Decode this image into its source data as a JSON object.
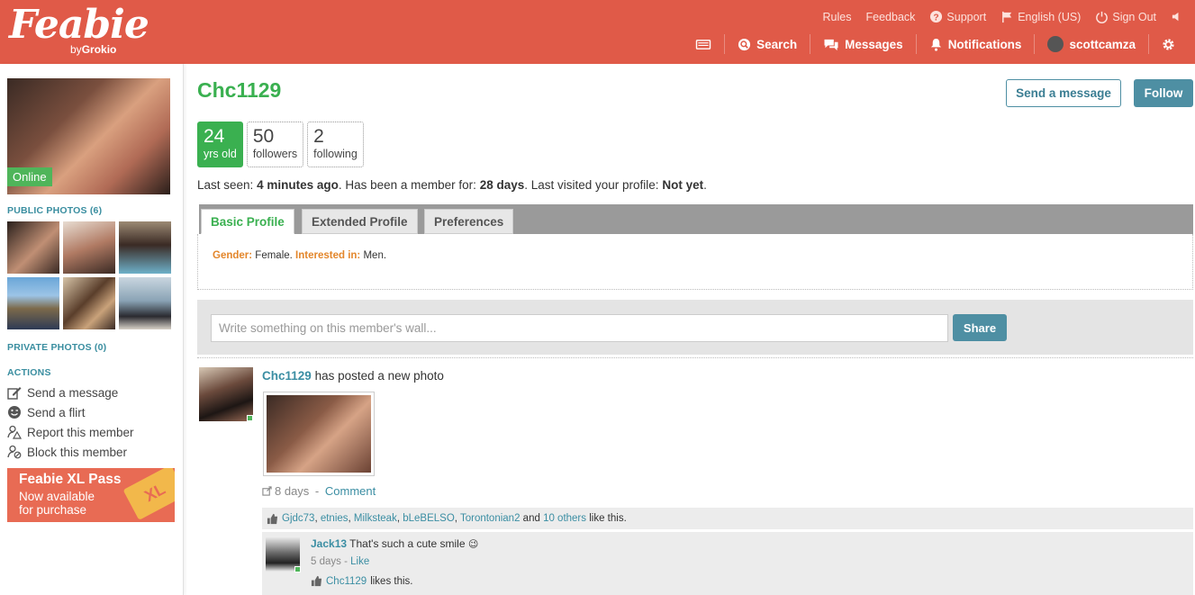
{
  "brand": {
    "name": "Feabie",
    "by_prefix": "by",
    "by_name": "Grokio"
  },
  "colors": {
    "header": "#e05a48",
    "green": "#3ab050",
    "teal": "#4e8fa3",
    "orange": "#e3862b",
    "online": "#4fb55a"
  },
  "top_links": [
    {
      "label": "Rules",
      "icon": ""
    },
    {
      "label": "Feedback",
      "icon": ""
    },
    {
      "label": "Support",
      "icon": "question-icon"
    },
    {
      "label": "English (US)",
      "icon": "flag-icon"
    },
    {
      "label": "Sign Out",
      "icon": "power-icon"
    }
  ],
  "nav": {
    "search": "Search",
    "messages": "Messages",
    "notifications": "Notifications",
    "username": "scottcamza"
  },
  "left": {
    "online_badge": "Online",
    "public_photos_title": "PUBLIC PHOTOS (6)",
    "private_photos_title": "PRIVATE PHOTOS (0)",
    "actions_title": "ACTIONS",
    "actions": {
      "send_message": "Send a message",
      "send_flirt": "Send a flirt",
      "report": "Report this member",
      "block": "Block this member"
    },
    "xl_pass": {
      "title": "Feabie XL Pass",
      "line1": "Now available",
      "line2": "for purchase",
      "badge": "XL"
    }
  },
  "profile": {
    "username": "Chc1129",
    "send_message_button": "Send a message",
    "follow_button": "Follow",
    "stats": {
      "age": {
        "value": "24",
        "label": "yrs old"
      },
      "followers": {
        "value": "50",
        "label": "followers"
      },
      "following": {
        "value": "2",
        "label": "following"
      }
    },
    "last_seen": {
      "prefix": "Last seen:",
      "value": "4 minutes ago",
      "member_prefix": ". Has been a member for:",
      "member_value": "28 days",
      "visited_prefix": ". Last visited your profile:",
      "visited_value": "Not yet",
      "end": "."
    },
    "tabs": {
      "basic": "Basic Profile",
      "extended": "Extended Profile",
      "preferences": "Preferences"
    },
    "basic": {
      "gender_label": "Gender:",
      "gender_value": "Female.",
      "interested_label": "Interested in:",
      "interested_value": "Men."
    }
  },
  "wall": {
    "placeholder": "Write something on this member's wall...",
    "share_button": "Share"
  },
  "post": {
    "author": "Chc1129",
    "action_text": "has posted a new photo",
    "age": "8 days",
    "separator": " - ",
    "comment_link": "Comment",
    "likers": [
      "Gjdc73",
      "etnies",
      "Milksteak",
      "bLeBELSO",
      "Torontonian2"
    ],
    "and_text": "and",
    "others_link": "10 others",
    "like_suffix": "like this."
  },
  "comment": {
    "author": "Jack13",
    "text": "That's such a cute smile",
    "emoji": "😉",
    "age": "5 days",
    "separator": " - ",
    "like_link": "Like",
    "liked_by": "Chc1129",
    "liked_suffix": "likes this."
  }
}
